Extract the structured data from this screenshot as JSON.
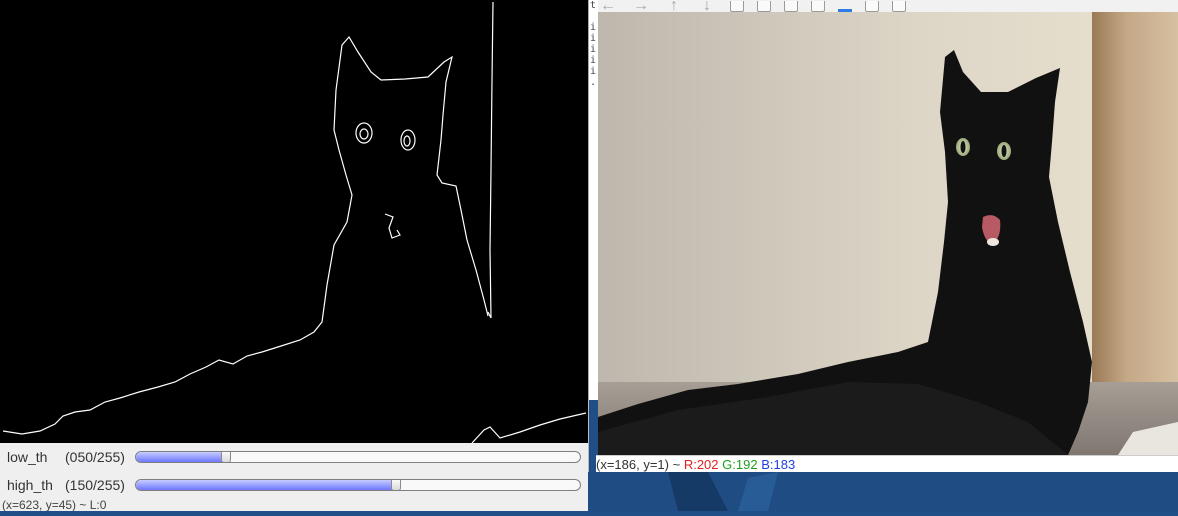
{
  "edges_window": {
    "trackbars": [
      {
        "name": "low_th",
        "value_text": "(050/255)",
        "value": 50,
        "max": 255
      },
      {
        "name": "high_th",
        "value_text": "(150/255)",
        "value": 150,
        "max": 255
      }
    ],
    "status": "(x=623, y=45) ~ L:0"
  },
  "terminal": {
    "lines": [
      "t",
      "",
      "i",
      "i",
      "i",
      "i",
      "i",
      "."
    ]
  },
  "image_window": {
    "toolbar": [
      {
        "icon": "arrow-left-icon",
        "glyph": "←"
      },
      {
        "icon": "arrow-right-icon",
        "glyph": "→"
      },
      {
        "icon": "arrow-up-icon",
        "glyph": "↑"
      },
      {
        "icon": "arrow-down-icon",
        "glyph": "↓"
      },
      {
        "icon": "zoom-in-icon"
      },
      {
        "icon": "zoom-fit-icon"
      },
      {
        "icon": "zoom-original-icon"
      },
      {
        "icon": "zoom-out-icon"
      },
      {
        "icon": "save-icon"
      },
      {
        "icon": "copy-icon"
      },
      {
        "icon": "properties-icon"
      }
    ],
    "status": {
      "coords": "(x=186, y=1) ~",
      "r": "R:202",
      "g": "G:192",
      "b": "B:183"
    }
  }
}
